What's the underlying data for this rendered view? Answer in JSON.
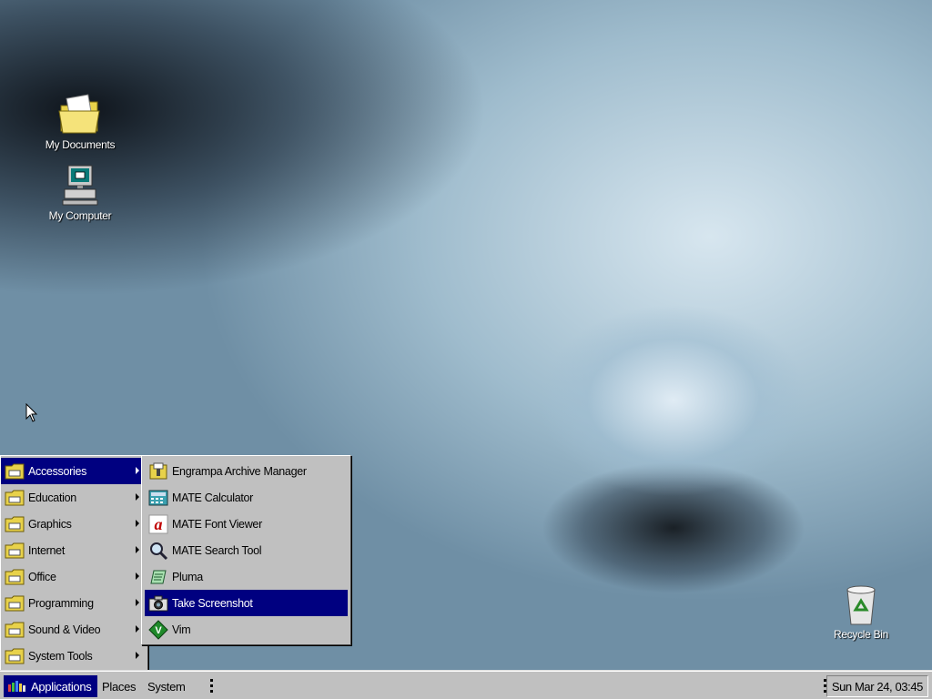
{
  "desktop": {
    "icons": [
      {
        "label": "My Documents",
        "icon": "folder-documents-icon"
      },
      {
        "label": "My Computer",
        "icon": "computer-icon"
      },
      {
        "label": "Recycle Bin",
        "icon": "recycle-bin-icon"
      }
    ]
  },
  "menu": {
    "categories": [
      {
        "label": "Accessories",
        "selected": true
      },
      {
        "label": "Education"
      },
      {
        "label": "Graphics"
      },
      {
        "label": "Internet"
      },
      {
        "label": "Office"
      },
      {
        "label": "Programming"
      },
      {
        "label": "Sound & Video"
      },
      {
        "label": "System Tools"
      }
    ],
    "accessories": [
      {
        "label": "Engrampa Archive Manager",
        "icon": "archive-icon"
      },
      {
        "label": "MATE Calculator",
        "icon": "calculator-icon"
      },
      {
        "label": "MATE Font Viewer",
        "icon": "font-icon"
      },
      {
        "label": "MATE Search Tool",
        "icon": "search-icon"
      },
      {
        "label": "Pluma",
        "icon": "text-editor-icon"
      },
      {
        "label": "Take Screenshot",
        "icon": "camera-icon",
        "selected": true
      },
      {
        "label": "Vim",
        "icon": "vim-icon"
      }
    ]
  },
  "taskbar": {
    "applications": "Applications",
    "places": "Places",
    "system": "System",
    "clock": "Sun Mar 24, 03:45"
  },
  "colors": {
    "selection": "#000080",
    "panel": "#c0c0c0"
  }
}
